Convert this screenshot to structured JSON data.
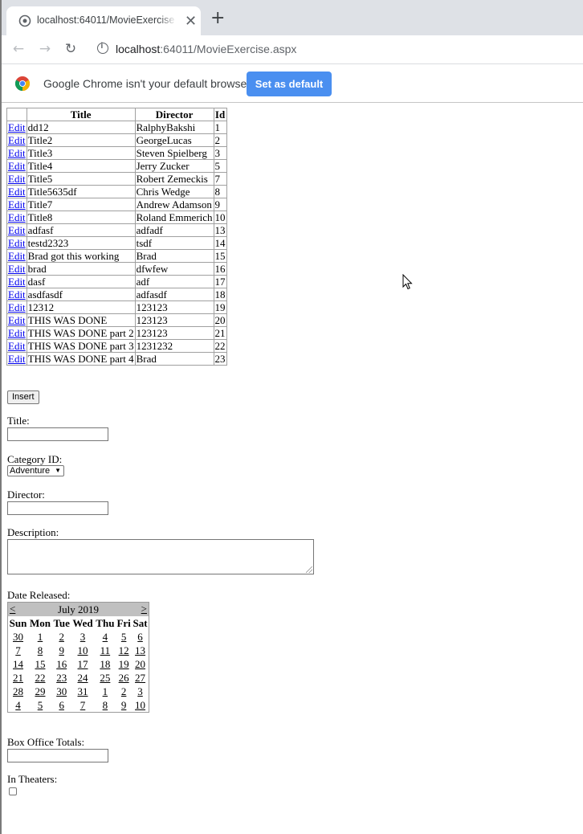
{
  "browser": {
    "tab_title": "localhost:64011/MovieExercise.aspx",
    "close_glyph": "✕",
    "new_tab_glyph": "+",
    "url_host": "localhost",
    "url_rest": ":64011/MovieExercise.aspx",
    "infobar_message": "Google Chrome isn't your default browser",
    "set_default_label": "Set as default",
    "accent_color": "#4a8ff0"
  },
  "grid": {
    "columns": [
      "",
      "Title",
      "Director",
      "Id"
    ],
    "edit_label": "Edit",
    "rows": [
      {
        "title": "dd12",
        "director": "RalphyBakshi",
        "id": "1"
      },
      {
        "title": "Title2",
        "director": "GeorgeLucas",
        "id": "2"
      },
      {
        "title": "Title3",
        "director": "Steven Spielberg",
        "id": "3"
      },
      {
        "title": "Title4",
        "director": "Jerry Zucker",
        "id": "5"
      },
      {
        "title": "Title5",
        "director": "Robert Zemeckis",
        "id": "7"
      },
      {
        "title": "Title5635df",
        "director": "Chris Wedge",
        "id": "8"
      },
      {
        "title": "Title7",
        "director": "Andrew Adamson",
        "id": "9"
      },
      {
        "title": "Title8",
        "director": "Roland Emmerich",
        "id": "10"
      },
      {
        "title": "adfasf",
        "director": "adfadf",
        "id": "13"
      },
      {
        "title": "testd2323",
        "director": "tsdf",
        "id": "14"
      },
      {
        "title": "Brad got this working",
        "director": "Brad",
        "id": "15"
      },
      {
        "title": "brad",
        "director": "dfwfew",
        "id": "16"
      },
      {
        "title": "dasf",
        "director": "adf",
        "id": "17"
      },
      {
        "title": "asdfasdf",
        "director": "adfasdf",
        "id": "18"
      },
      {
        "title": "12312",
        "director": "123123",
        "id": "19"
      },
      {
        "title": "THIS WAS DONE",
        "director": "123123",
        "id": "20"
      },
      {
        "title": "THIS WAS DONE part 2",
        "director": "123123",
        "id": "21"
      },
      {
        "title": "THIS WAS DONE part 3",
        "director": "1231232",
        "id": "22"
      },
      {
        "title": "THIS WAS DONE part 4",
        "director": "Brad",
        "id": "23"
      }
    ]
  },
  "form": {
    "insert_label": "Insert",
    "title_label": "Title:",
    "title_value": "",
    "category_label": "Category ID:",
    "category_selected": "Adventure",
    "director_label": "Director:",
    "director_value": "",
    "description_label": "Description:",
    "description_value": "",
    "date_label": "Date Released:",
    "box_office_label": "Box Office Totals:",
    "box_office_value": "",
    "in_theaters_label": "In Theaters:",
    "in_theaters_checked": false
  },
  "calendar": {
    "prev": "<",
    "next": ">",
    "month_title": "July 2019",
    "days_of_week": [
      "Sun",
      "Mon",
      "Tue",
      "Wed",
      "Thu",
      "Fri",
      "Sat"
    ],
    "weeks": [
      [
        "30",
        "1",
        "2",
        "3",
        "4",
        "5",
        "6"
      ],
      [
        "7",
        "8",
        "9",
        "10",
        "11",
        "12",
        "13"
      ],
      [
        "14",
        "15",
        "16",
        "17",
        "18",
        "19",
        "20"
      ],
      [
        "21",
        "22",
        "23",
        "24",
        "25",
        "26",
        "27"
      ],
      [
        "28",
        "29",
        "30",
        "31",
        "1",
        "2",
        "3"
      ],
      [
        "4",
        "5",
        "6",
        "7",
        "8",
        "9",
        "10"
      ]
    ]
  }
}
